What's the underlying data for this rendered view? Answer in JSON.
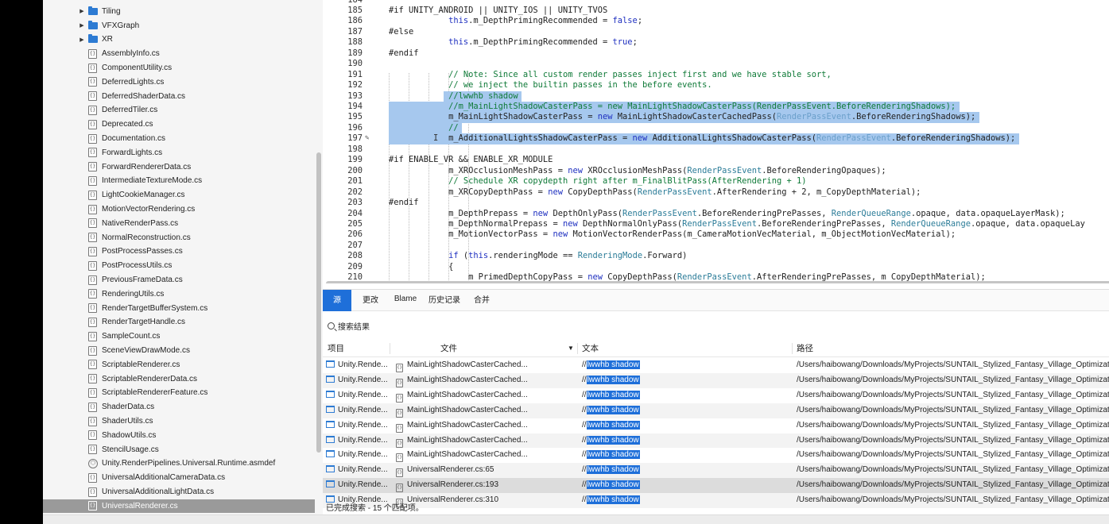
{
  "sidebar": {
    "folders": [
      "Tiling",
      "VFXGraph",
      "XR"
    ],
    "files": [
      "AssemblyInfo.cs",
      "ComponentUtility.cs",
      "DeferredLights.cs",
      "DeferredShaderData.cs",
      "DeferredTiler.cs",
      "Deprecated.cs",
      "Documentation.cs",
      "ForwardLights.cs",
      "ForwardRendererData.cs",
      "IntermediateTextureMode.cs",
      "LightCookieManager.cs",
      "MotionVectorRendering.cs",
      "NativeRenderPass.cs",
      "NormalReconstruction.cs",
      "PostProcessPasses.cs",
      "PostProcessUtils.cs",
      "PreviousFrameData.cs",
      "RenderingUtils.cs",
      "RenderTargetBufferSystem.cs",
      "RenderTargetHandle.cs",
      "SampleCount.cs",
      "SceneViewDrawMode.cs",
      "ScriptableRenderer.cs",
      "ScriptableRendererData.cs",
      "ScriptableRendererFeature.cs",
      "ShaderData.cs",
      "ShaderUtils.cs",
      "ShadowUtils.cs",
      "StencilUsage.cs",
      "Unity.RenderPipelines.Universal.Runtime.asmdef",
      "UniversalAdditionalCameraData.cs",
      "UniversalAdditionalLightData.cs",
      "UniversalRenderer.cs"
    ],
    "selected_file": "UniversalRenderer.cs"
  },
  "editor": {
    "lines": [
      {
        "n": "184",
        "t": ""
      },
      {
        "n": "185",
        "t": "#if UNITY_ANDROID || UNITY_IOS || UNITY_TVOS"
      },
      {
        "n": "186",
        "t": "            this.m_DepthPrimingRecommended = false;"
      },
      {
        "n": "187",
        "t": "#else"
      },
      {
        "n": "188",
        "t": "            this.m_DepthPrimingRecommended = true;"
      },
      {
        "n": "189",
        "t": "#endif"
      },
      {
        "n": "190",
        "t": ""
      },
      {
        "n": "191",
        "t": "            // Note: Since all custom render passes inject first and we have stable sort,"
      },
      {
        "n": "192",
        "t": "            // we inject the builtin passes in the before events."
      },
      {
        "n": "193",
        "t": "            //lwwhb shadow"
      },
      {
        "n": "194",
        "t": "            //m_MainLightShadowCasterPass = new MainLightShadowCasterPass(RenderPassEvent.BeforeRenderingShadows);"
      },
      {
        "n": "195",
        "t": "            m_MainLightShadowCasterPass = new MainLightShadowCasterCachedPass(RenderPassEvent.BeforeRenderingShadows);"
      },
      {
        "n": "196",
        "t": "            //"
      },
      {
        "n": "197",
        "t": "            m_AdditionalLightsShadowCasterPass = new AdditionalLightsShadowCasterPass(RenderPassEvent.BeforeRenderingShadows);"
      },
      {
        "n": "198",
        "t": ""
      },
      {
        "n": "199",
        "t": "#if ENABLE_VR && ENABLE_XR_MODULE"
      },
      {
        "n": "200",
        "t": "            m_XROcclusionMeshPass = new XROcclusionMeshPass(RenderPassEvent.BeforeRenderingOpaques);"
      },
      {
        "n": "201",
        "t": "            // Schedule XR copydepth right after m_FinalBlitPass(AfterRendering + 1)"
      },
      {
        "n": "202",
        "t": "            m_XRCopyDepthPass = new CopyDepthPass(RenderPassEvent.AfterRendering + 2, m_CopyDepthMaterial);"
      },
      {
        "n": "203",
        "t": "#endif"
      },
      {
        "n": "204",
        "t": "            m_DepthPrepass = new DepthOnlyPass(RenderPassEvent.BeforeRenderingPrePasses, RenderQueueRange.opaque, data.opaqueLayerMask);"
      },
      {
        "n": "205",
        "t": "            m_DepthNormalPrepass = new DepthNormalOnlyPass(RenderPassEvent.BeforeRenderingPrePasses, RenderQueueRange.opaque, data.opaqueLay"
      },
      {
        "n": "206",
        "t": "            m_MotionVectorPass = new MotionVectorRenderPass(m_CameraMotionVecMaterial, m_ObjectMotionVecMaterial);"
      },
      {
        "n": "207",
        "t": ""
      },
      {
        "n": "208",
        "t": "            if (this.renderingMode == RenderingMode.Forward)"
      },
      {
        "n": "209",
        "t": "            {"
      },
      {
        "n": "210",
        "t": "                m_PrimedDepthCopyPass = new CopyDepthPass(RenderPassEvent.AfterRenderingPrePasses, m_CopyDepthMaterial);"
      }
    ]
  },
  "bottom_panel": {
    "tabs": [
      "源",
      "更改",
      "Blame",
      "历史记录",
      "合并"
    ],
    "active_tab": "源",
    "search_label": "搜索结果",
    "columns": {
      "project": "项目",
      "file": "文件",
      "text": "文本",
      "path": "路径"
    },
    "results": [
      {
        "project": "Unity.Rende...",
        "file": "MainLightShadowCasterCached...",
        "prefix": "//",
        "match": "lwwhb shadow",
        "path": "/Users/haibowang/Downloads/MyProjects/SUNTAIL_Stylized_Fantasy_Village_Optimization/Packages"
      },
      {
        "project": "Unity.Rende...",
        "file": "MainLightShadowCasterCached...",
        "prefix": "//",
        "match": "lwwhb shadow",
        "path": "/Users/haibowang/Downloads/MyProjects/SUNTAIL_Stylized_Fantasy_Village_Optimization/Packages"
      },
      {
        "project": "Unity.Rende...",
        "file": "MainLightShadowCasterCached...",
        "prefix": "//",
        "match": "lwwhb shadow",
        "path": "/Users/haibowang/Downloads/MyProjects/SUNTAIL_Stylized_Fantasy_Village_Optimization/Packages"
      },
      {
        "project": "Unity.Rende...",
        "file": "MainLightShadowCasterCached...",
        "prefix": "//",
        "match": "lwwhb shadow",
        "path": "/Users/haibowang/Downloads/MyProjects/SUNTAIL_Stylized_Fantasy_Village_Optimization/Packages"
      },
      {
        "project": "Unity.Rende...",
        "file": "MainLightShadowCasterCached...",
        "prefix": "//",
        "match": "lwwhb shadow",
        "path": "/Users/haibowang/Downloads/MyProjects/SUNTAIL_Stylized_Fantasy_Village_Optimization/Packages"
      },
      {
        "project": "Unity.Rende...",
        "file": "MainLightShadowCasterCached...",
        "prefix": "//",
        "match": "lwwhb shadow",
        "path": "/Users/haibowang/Downloads/MyProjects/SUNTAIL_Stylized_Fantasy_Village_Optimization/Packages"
      },
      {
        "project": "Unity.Rende...",
        "file": "MainLightShadowCasterCached...",
        "prefix": "//",
        "match": "lwwhb shadow",
        "path": "/Users/haibowang/Downloads/MyProjects/SUNTAIL_Stylized_Fantasy_Village_Optimization/Packages"
      },
      {
        "project": "Unity.Rende...",
        "file": "UniversalRenderer.cs:65",
        "prefix": "//",
        "match": "lwwhb shadow",
        "path": "/Users/haibowang/Downloads/MyProjects/SUNTAIL_Stylized_Fantasy_Village_Optimization/Packages"
      },
      {
        "project": "Unity.Rende...",
        "file": "UniversalRenderer.cs:193",
        "prefix": "//",
        "match": "lwwhb shadow",
        "path": "/Users/haibowang/Downloads/MyProjects/SUNTAIL_Stylized_Fantasy_Village_Optimization/Packages"
      },
      {
        "project": "Unity.Rende...",
        "file": "UniversalRenderer.cs:310",
        "prefix": "//",
        "match": "lwwhb shadow",
        "path": "/Users/haibowang/Downloads/MyProjects/SUNTAIL_Stylized_Fantasy_Village_Optimization/Packages"
      }
    ],
    "selected_result": 8,
    "status": "已完成搜索 - 15 个匹配项。"
  },
  "colors": {
    "accent": "#1e6fd9",
    "selection": "#a6c8ee",
    "folder": "#2d7bd3",
    "keyword": "#1f30c0",
    "comment": "#0f7a38"
  }
}
